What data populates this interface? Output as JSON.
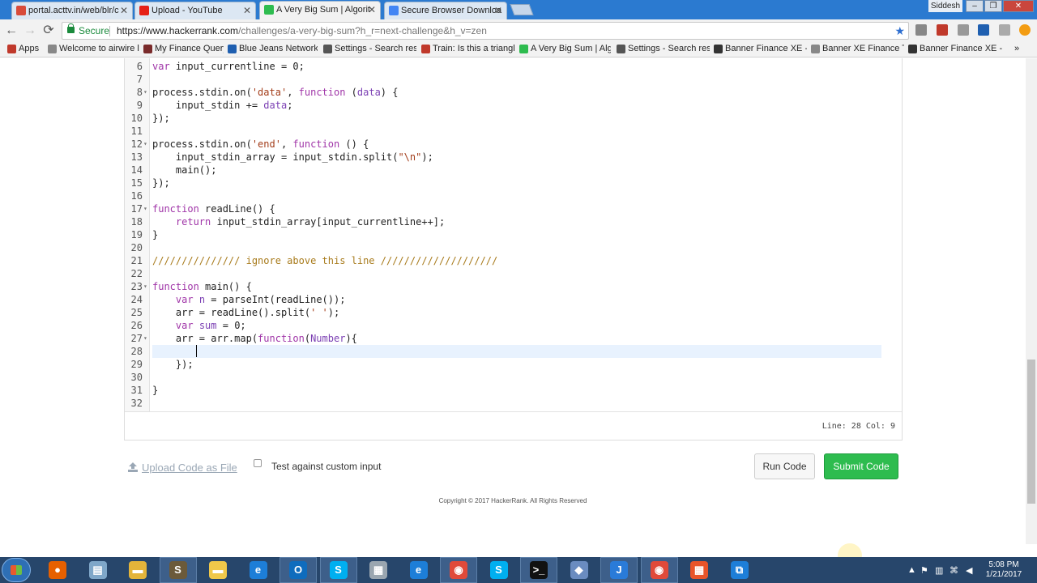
{
  "tabs": [
    {
      "title": "portal.acttv.in/web/blr/c",
      "favicon_color": "#d84b3a"
    },
    {
      "title": "Upload - YouTube",
      "favicon_color": "#e62117"
    },
    {
      "title": "A Very Big Sum | Algorit",
      "favicon_color": "#2ebc4f",
      "active": true
    },
    {
      "title": "Secure Browser Downloa",
      "favicon_color": "#4285f4"
    }
  ],
  "window": {
    "profile": "Siddesh",
    "minimize": "–",
    "restore": "❐",
    "close": "✕"
  },
  "toolbar": {
    "back": "←",
    "forward": "→",
    "reload": "⟳",
    "secure_label": "Secure",
    "url_host": "https://www.hackerrank.com",
    "url_path": "/challenges/a-very-big-sum?h_r=next-challenge&h_v=zen",
    "star": "★"
  },
  "bookmarks": [
    {
      "label": "Apps",
      "color": "#c0392b"
    },
    {
      "label": "Welcome to airwire lo",
      "color": "#888888"
    },
    {
      "label": "My Finance Query",
      "color": "#7a2b2b"
    },
    {
      "label": "Blue Jeans Network |",
      "color": "#1f5fb0"
    },
    {
      "label": "Settings - Search resu",
      "color": "#555555"
    },
    {
      "label": "Train: Is this a triangle",
      "color": "#c0392b"
    },
    {
      "label": "A Very Big Sum | Algo",
      "color": "#2ebc4f"
    },
    {
      "label": "Settings - Search resu",
      "color": "#555555"
    },
    {
      "label": "Banner Finance XE - B",
      "color": "#333333"
    },
    {
      "label": "Banner XE Finance Te",
      "color": "#888888"
    },
    {
      "label": "Banner Finance XE - E",
      "color": "#333333"
    }
  ],
  "bookmarks_overflow": "»",
  "editor": {
    "lines": [
      {
        "n": "6",
        "fold": "",
        "html": "<span class=\"kw\">var</span> input_currentline = 0;"
      },
      {
        "n": "7",
        "fold": "",
        "html": ""
      },
      {
        "n": "8",
        "fold": "▾",
        "html": "process.stdin.on(<span class=\"str\">'data'</span>, <span class=\"kw\">function</span> (<span class=\"var\">data</span>) {"
      },
      {
        "n": "9",
        "fold": "",
        "html": "    input_stdin += <span class=\"var\">data</span>;"
      },
      {
        "n": "10",
        "fold": "",
        "html": "});"
      },
      {
        "n": "11",
        "fold": "",
        "html": ""
      },
      {
        "n": "12",
        "fold": "▾",
        "html": "process.stdin.on(<span class=\"str\">'end'</span>, <span class=\"kw\">function</span> () {"
      },
      {
        "n": "13",
        "fold": "",
        "html": "    input_stdin_array = input_stdin.split(<span class=\"str\">\"\\n\"</span>);"
      },
      {
        "n": "14",
        "fold": "",
        "html": "    main();"
      },
      {
        "n": "15",
        "fold": "",
        "html": "});"
      },
      {
        "n": "16",
        "fold": "",
        "html": ""
      },
      {
        "n": "17",
        "fold": "▾",
        "html": "<span class=\"kw\">function</span> readLine() {"
      },
      {
        "n": "18",
        "fold": "",
        "html": "    <span class=\"kw\">return</span> input_stdin_array[input_currentline++];"
      },
      {
        "n": "19",
        "fold": "",
        "html": "}"
      },
      {
        "n": "20",
        "fold": "",
        "html": ""
      },
      {
        "n": "21",
        "fold": "",
        "html": "<span class=\"cmt\">/////////////// ignore above this line ////////////////////</span>"
      },
      {
        "n": "22",
        "fold": "",
        "html": ""
      },
      {
        "n": "23",
        "fold": "▾",
        "html": "<span class=\"kw\">function</span> main() {"
      },
      {
        "n": "24",
        "fold": "",
        "html": "    <span class=\"kw\">var</span> <span class=\"var\">n</span> = parseInt(readLine());"
      },
      {
        "n": "25",
        "fold": "",
        "html": "    arr = readLine().split(<span class=\"str\">' '</span>);"
      },
      {
        "n": "26",
        "fold": "",
        "html": "    <span class=\"kw\">var</span> <span class=\"var\">sum</span> = 0;"
      },
      {
        "n": "27",
        "fold": "▾",
        "html": "    arr = arr.map(<span class=\"kw\">function</span>(<span class=\"var\">Number</span>){"
      },
      {
        "n": "28",
        "fold": "",
        "html": "    ",
        "active": true
      },
      {
        "n": "29",
        "fold": "",
        "html": "    });"
      },
      {
        "n": "30",
        "fold": "",
        "html": ""
      },
      {
        "n": "31",
        "fold": "",
        "html": "}"
      },
      {
        "n": "32",
        "fold": "",
        "html": ""
      }
    ],
    "status": "Line: 28 Col: 9"
  },
  "actions": {
    "upload_label": "Upload Code as File",
    "custom_input_label": "Test against custom input",
    "run_label": "Run Code",
    "submit_label": "Submit Code"
  },
  "footer": {
    "copyright": "Copyright © 2017 HackerRank. All Rights Reserved"
  },
  "taskbar": {
    "apps": [
      {
        "name": "firefox",
        "glyph": "●",
        "color": "#e66000"
      },
      {
        "name": "notepad",
        "glyph": "▤",
        "color": "#7fa7c9"
      },
      {
        "name": "explorer",
        "glyph": "▬",
        "color": "#e3b43a"
      },
      {
        "name": "sublime",
        "glyph": "S",
        "color": "#6b5a3a",
        "running": true
      },
      {
        "name": "folder",
        "glyph": "▬",
        "color": "#f0c84a"
      },
      {
        "name": "ie",
        "glyph": "e",
        "color": "#1d7ed8"
      },
      {
        "name": "outlook",
        "glyph": "O",
        "color": "#0f6cbd",
        "running": true
      },
      {
        "name": "skype",
        "glyph": "S",
        "color": "#00aff0",
        "running": true
      },
      {
        "name": "calculator",
        "glyph": "▦",
        "color": "#9aa6b0"
      },
      {
        "name": "ie2",
        "glyph": "e",
        "color": "#1d7ed8"
      },
      {
        "name": "chrome",
        "glyph": "◉",
        "color": "#e04a3a",
        "running": true
      },
      {
        "name": "skype2",
        "glyph": "S",
        "color": "#00aff0"
      },
      {
        "name": "cmd",
        "glyph": ">_",
        "color": "#111111",
        "running": true
      },
      {
        "name": "tool",
        "glyph": "◆",
        "color": "#6a8cc0"
      },
      {
        "name": "intellij",
        "glyph": "J",
        "color": "#2a7bd8",
        "running": true
      },
      {
        "name": "chrome2",
        "glyph": "◉",
        "color": "#e04a3a",
        "running": true
      },
      {
        "name": "office",
        "glyph": "▦",
        "color": "#e8542a"
      },
      {
        "name": "snip",
        "glyph": "⧉",
        "color": "#1d7ed8"
      }
    ],
    "tray": {
      "time": "5:08 PM",
      "date": "1/21/2017"
    }
  }
}
